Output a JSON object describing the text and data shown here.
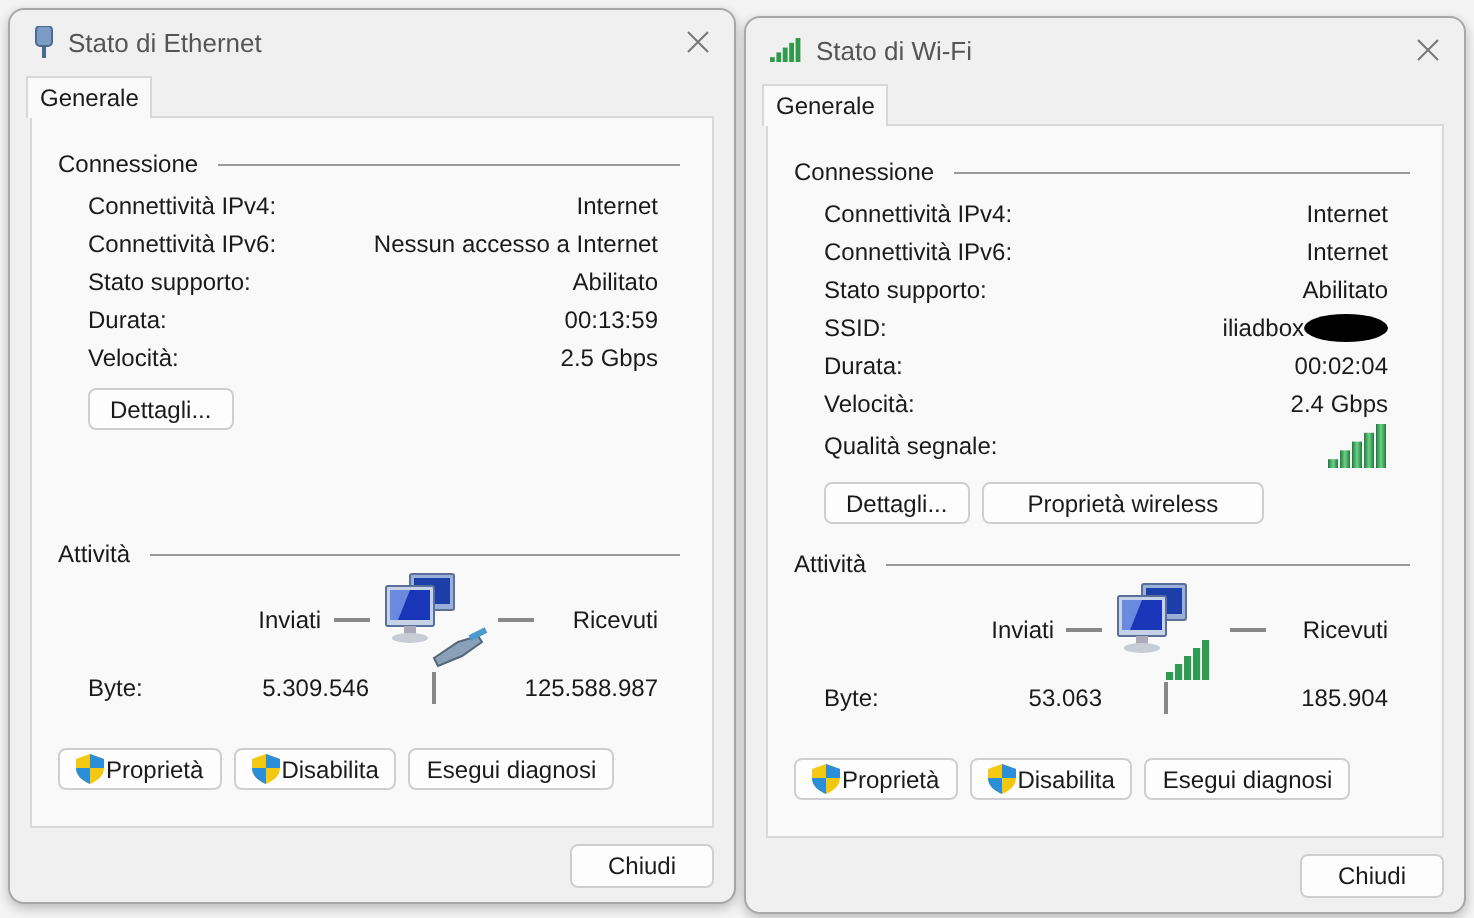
{
  "windows": [
    {
      "title": "Stato di Ethernet",
      "kind": "ethernet",
      "tabs": [
        {
          "label": "Generale",
          "selected": true
        }
      ],
      "connection": {
        "heading": "Connessione",
        "rows": [
          {
            "kind": "text",
            "label": "Connettività IPv4:",
            "value": "Internet"
          },
          {
            "kind": "text",
            "label": "Connettività IPv6:",
            "value": "Nessun accesso a Internet"
          },
          {
            "kind": "text",
            "label": "Stato supporto:",
            "value": "Abilitato"
          },
          {
            "kind": "text",
            "label": "Durata:",
            "value": "00:13:59"
          },
          {
            "kind": "text",
            "label": "Velocità:",
            "value": "2.5 Gbps"
          }
        ]
      },
      "connection_buttons": [
        "Dettagli..."
      ],
      "activity": {
        "heading": "Attività",
        "sent_label": "Inviati",
        "received_label": "Ricevuti",
        "bytes_label": "Byte:",
        "sent": "5.309.546",
        "received": "125.588.987"
      },
      "buttons": [
        {
          "label": "Proprietà",
          "shield": true
        },
        {
          "label": "Disabilita",
          "shield": true
        },
        {
          "label": "Esegui diagnosi",
          "shield": false
        }
      ],
      "close_button": "Chiudi"
    },
    {
      "title": "Stato di Wi-Fi",
      "kind": "wifi",
      "tabs": [
        {
          "label": "Generale",
          "selected": true
        }
      ],
      "connection": {
        "heading": "Connessione",
        "rows": [
          {
            "kind": "text",
            "label": "Connettività IPv4:",
            "value": "Internet"
          },
          {
            "kind": "text",
            "label": "Connettività IPv6:",
            "value": "Internet"
          },
          {
            "kind": "text",
            "label": "Stato supporto:",
            "value": "Abilitato"
          },
          {
            "kind": "redacted",
            "label": "SSID:",
            "value": "iliadbox"
          },
          {
            "kind": "text",
            "label": "Durata:",
            "value": "00:02:04"
          },
          {
            "kind": "text",
            "label": "Velocità:",
            "value": "2.4 Gbps"
          },
          {
            "kind": "signal",
            "label": "Qualità segnale:"
          }
        ]
      },
      "connection_buttons": [
        "Dettagli...",
        "Proprietà wireless"
      ],
      "activity": {
        "heading": "Attività",
        "sent_label": "Inviati",
        "received_label": "Ricevuti",
        "bytes_label": "Byte:",
        "sent": "53.063",
        "received": "185.904"
      },
      "buttons": [
        {
          "label": "Proprietà",
          "shield": true
        },
        {
          "label": "Disabilita",
          "shield": true
        },
        {
          "label": "Esegui diagnosi",
          "shield": false
        }
      ],
      "close_button": "Chiudi"
    }
  ]
}
